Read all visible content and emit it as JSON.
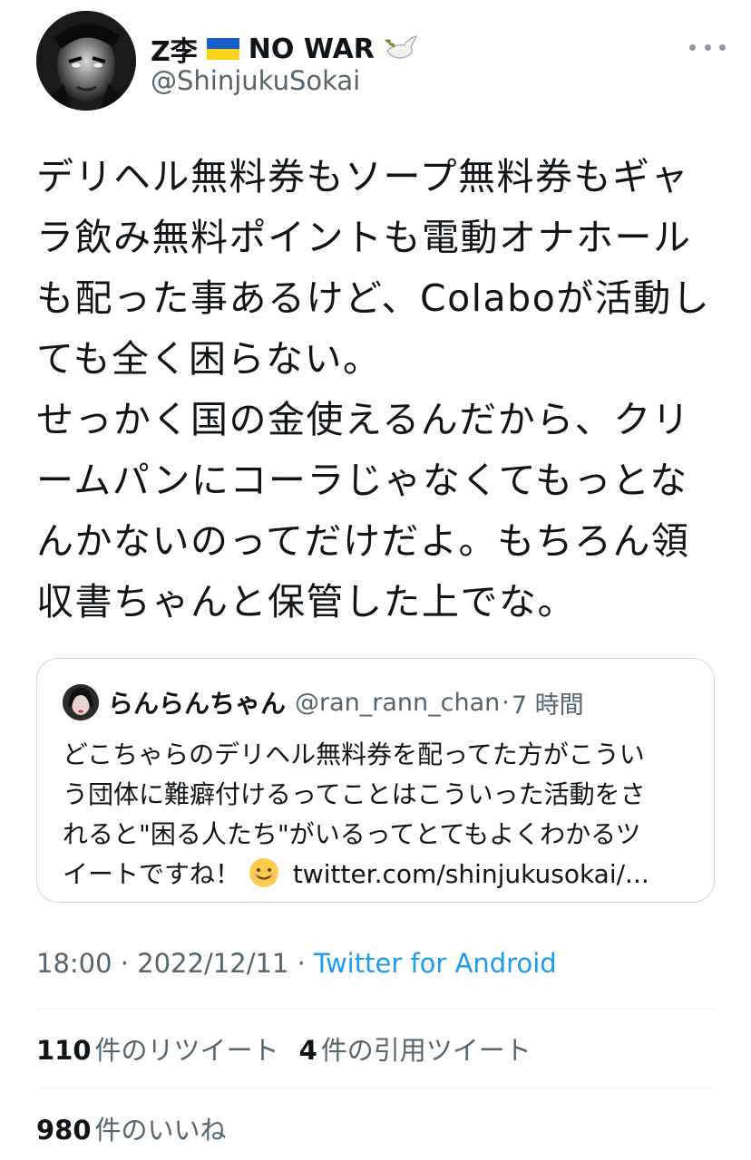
{
  "author": {
    "display_name": "Z李",
    "flag_icon": "ukraine-flag",
    "slogan": "NO WAR",
    "dove_icon": "dove-with-olive-branch",
    "handle": "@ShinjukuSokai"
  },
  "more_icon": "more-horizontal-icon",
  "tweet": {
    "lines": [
      "デリヘル無料券もソープ無料券もギャ",
      "ラ飲み無料ポイントも電動オナホール",
      "も配った事あるけど、Colaboが活動し",
      "ても全く困らない。",
      "せっかく国の金使えるんだから、クリ",
      "ームパンにコーラじゃなくてもっとな",
      "んかないのってだけだよ。もちろん領",
      "収書ちゃんと保管した上でな。"
    ]
  },
  "quote": {
    "display_name": "らんらんちゃん",
    "handle": "@ran_rann_chan",
    "separator": "·",
    "time": "7 時間",
    "lines": [
      "どこちゃらのデリヘル無料券を配ってた方がこうい",
      "う団体に難癖付けるってことはこういった活動をさ",
      "れると\"困る人たち\"がいるってとてもよくわかるツ"
    ],
    "last_line_text": "イートですね！",
    "emoji": "smiling-face-emoji",
    "link": "twitter.com/shinjukusokai/..."
  },
  "meta": {
    "time": "18:00",
    "sep1": " · ",
    "date": "2022/12/11",
    "sep2": " · ",
    "source": "Twitter for Android"
  },
  "stats": {
    "retweets_count": "110",
    "retweets_label": "件のリツイート",
    "quotes_count": "4",
    "quotes_label": "件の引用ツイート",
    "likes_count": "980",
    "likes_label": "件のいいね"
  },
  "colors": {
    "link_blue": "#1d9bf0",
    "secondary_text": "#536471",
    "border": "#cfd9de"
  }
}
